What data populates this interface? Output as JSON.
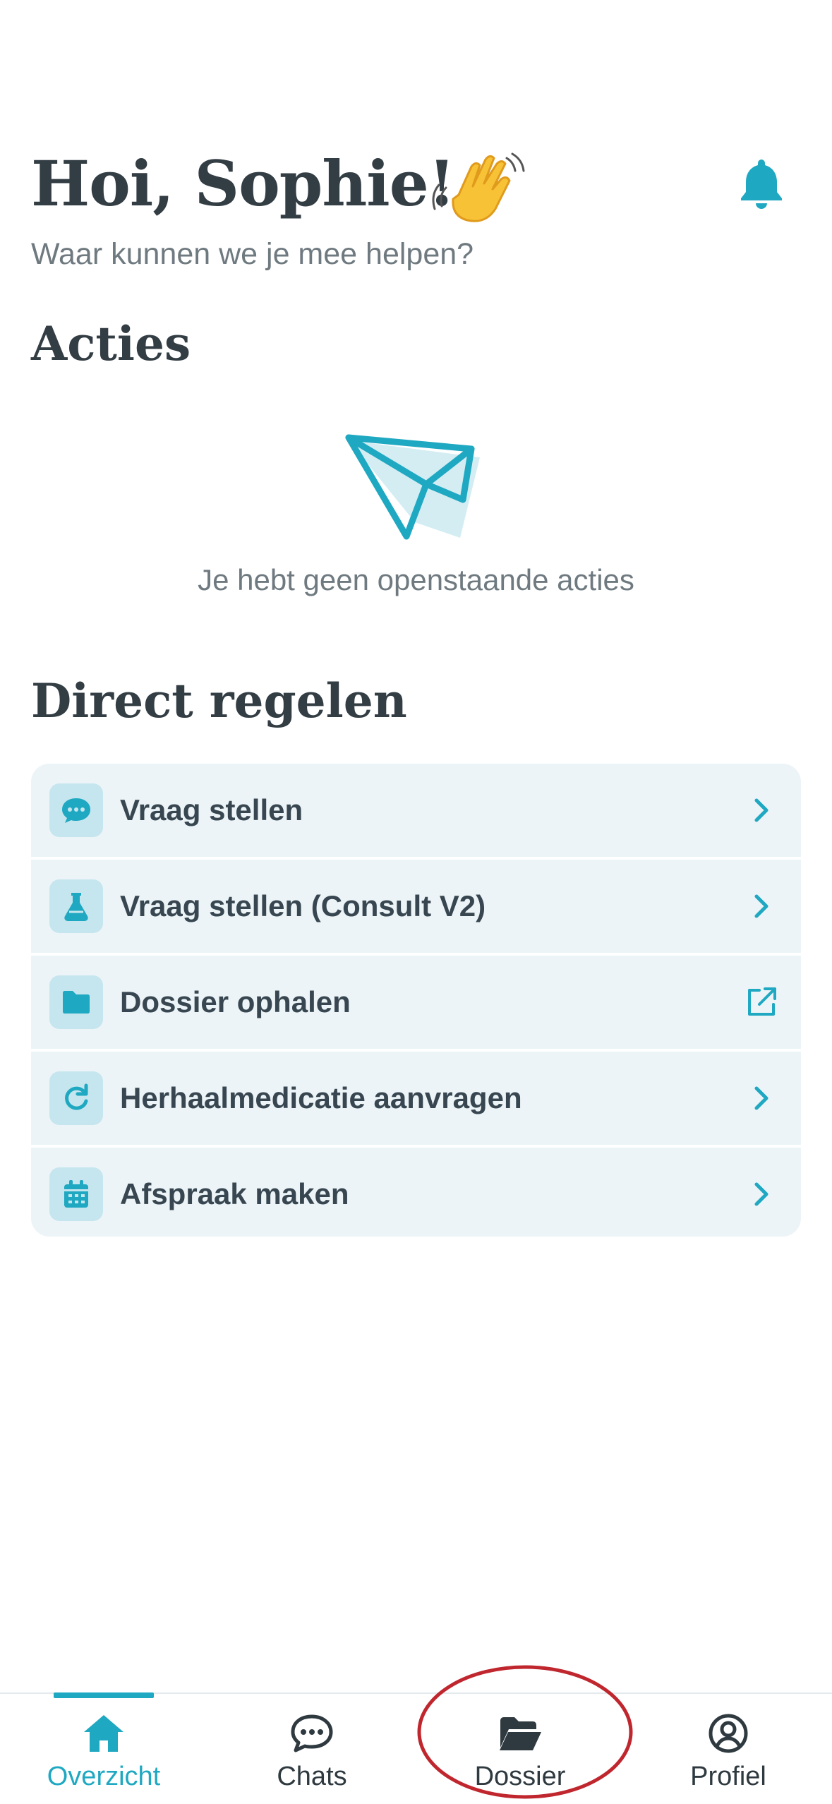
{
  "header": {
    "greeting": "Hoi, Sophie!",
    "subtitle": "Waar kunnen we je mee helpen?",
    "wave_icon": "waving-hand-emoji",
    "bell_icon": "bell-icon"
  },
  "actions_section": {
    "title": "Acties",
    "empty_icon": "paper-plane-icon",
    "empty_text": "Je hebt geen openstaande acties"
  },
  "direct_section": {
    "title": "Direct regelen",
    "items": [
      {
        "label": "Vraag stellen",
        "icon": "chat-bubble-icon",
        "trail": "chevron-right-icon"
      },
      {
        "label": "Vraag stellen (Consult V2)",
        "icon": "flask-icon",
        "trail": "chevron-right-icon"
      },
      {
        "label": "Dossier ophalen",
        "icon": "folder-icon",
        "trail": "external-link-icon"
      },
      {
        "label": "Herhaalmedicatie aanvragen",
        "icon": "repeat-icon",
        "trail": "chevron-right-icon"
      },
      {
        "label": "Afspraak maken",
        "icon": "calendar-icon",
        "trail": "chevron-right-icon"
      }
    ]
  },
  "bottom_nav": {
    "active": "Overzicht",
    "items": [
      {
        "label": "Overzicht",
        "icon": "home-icon"
      },
      {
        "label": "Chats",
        "icon": "chat-bubble-icon"
      },
      {
        "label": "Dossier",
        "icon": "folder-open-icon"
      },
      {
        "label": "Profiel",
        "icon": "user-circle-icon"
      }
    ]
  },
  "colors": {
    "accent": "#1fa8c1",
    "text_dark": "#333d44",
    "text_muted": "#6f7a80",
    "card_bg": "#ecf4f7",
    "icon_bg": "#c5e6ee",
    "annotation": "#c0262d"
  }
}
